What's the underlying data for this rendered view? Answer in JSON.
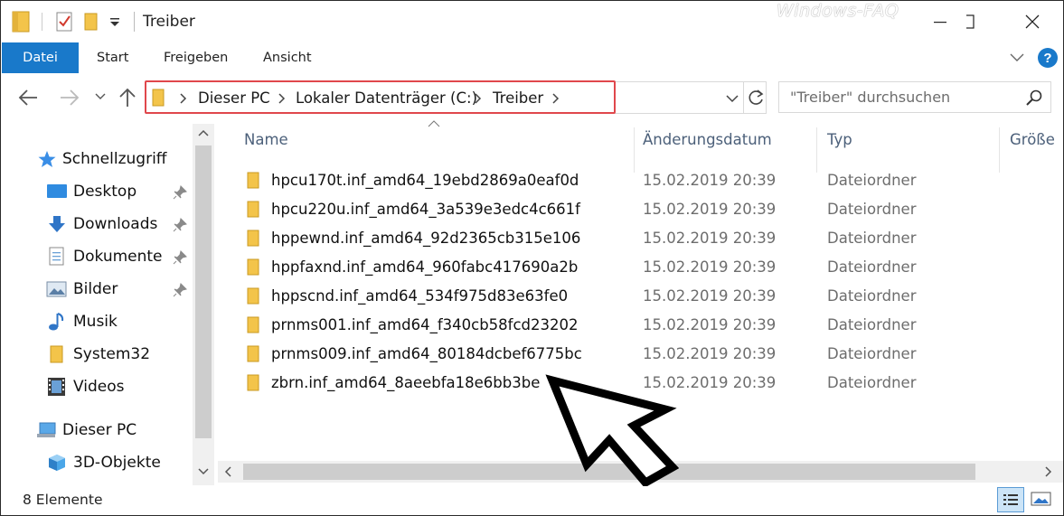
{
  "title": "Treiber",
  "watermark": "Windows-FAQ",
  "ribbon": {
    "tabs": [
      {
        "label": "Datei"
      },
      {
        "label": "Start"
      },
      {
        "label": "Freigeben"
      },
      {
        "label": "Ansicht"
      }
    ]
  },
  "address": {
    "crumbs": [
      "Dieser PC",
      "Lokaler Datenträger (C:)",
      "Treiber"
    ]
  },
  "search": {
    "placeholder": "\"Treiber\" durchsuchen"
  },
  "nav": {
    "items": [
      {
        "label": "Schnellzugriff",
        "icon": "star-icon"
      },
      {
        "label": "Desktop",
        "icon": "desktop-icon",
        "pinned": true
      },
      {
        "label": "Downloads",
        "icon": "download-icon",
        "pinned": true
      },
      {
        "label": "Dokumente",
        "icon": "document-icon",
        "pinned": true
      },
      {
        "label": "Bilder",
        "icon": "pictures-icon",
        "pinned": true
      },
      {
        "label": "Musik",
        "icon": "music-icon"
      },
      {
        "label": "System32",
        "icon": "folder-icon"
      },
      {
        "label": "Videos",
        "icon": "videos-icon"
      },
      {
        "label": "Dieser PC",
        "icon": "computer-icon"
      },
      {
        "label": "3D-Objekte",
        "icon": "3d-objects-icon"
      }
    ]
  },
  "columns": {
    "name": "Name",
    "date": "Änderungsdatum",
    "type": "Typ",
    "size": "Größe"
  },
  "files": [
    {
      "name": "hpcu170t.inf_amd64_19ebd2869a0eaf0d",
      "date": "15.02.2019 20:39",
      "type": "Dateiordner"
    },
    {
      "name": "hpcu220u.inf_amd64_3a539e3edc4c661f",
      "date": "15.02.2019 20:39",
      "type": "Dateiordner"
    },
    {
      "name": "hppewnd.inf_amd64_92d2365cb315e106",
      "date": "15.02.2019 20:39",
      "type": "Dateiordner"
    },
    {
      "name": "hppfaxnd.inf_amd64_960fabc417690a2b",
      "date": "15.02.2019 20:39",
      "type": "Dateiordner"
    },
    {
      "name": "hppscnd.inf_amd64_534f975d83e63fe0",
      "date": "15.02.2019 20:39",
      "type": "Dateiordner"
    },
    {
      "name": "prnms001.inf_amd64_f340cb58fcd23202",
      "date": "15.02.2019 20:39",
      "type": "Dateiordner"
    },
    {
      "name": "prnms009.inf_amd64_80184dcbef6775bc",
      "date": "15.02.2019 20:39",
      "type": "Dateiordner"
    },
    {
      "name": "zbrn.inf_amd64_8aeebfa18e6bb3be",
      "date": "15.02.2019 20:39",
      "type": "Dateiordner"
    }
  ],
  "status": {
    "count": "8 Elemente"
  },
  "colors": {
    "accent": "#1979ca",
    "highlight": "#e0474c",
    "folder": "#f3c44a"
  }
}
